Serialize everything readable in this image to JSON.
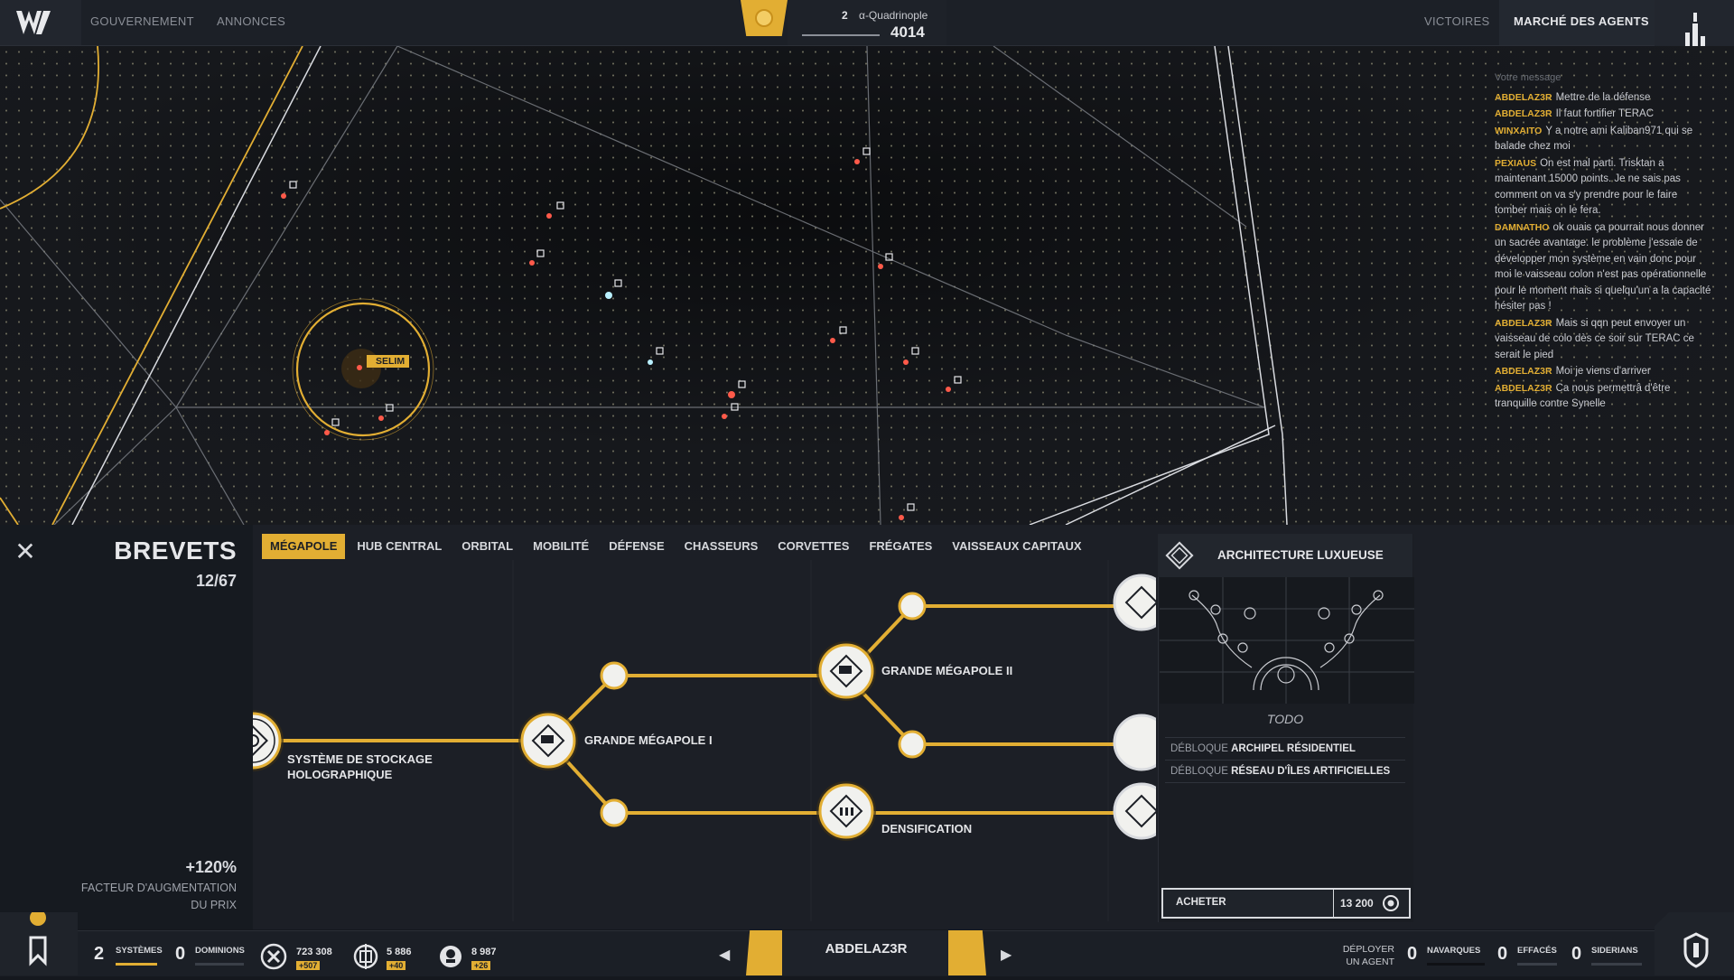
{
  "topbar": {
    "nav_left": [
      "GOUVERNEMENT",
      "ANNONCES"
    ],
    "nav_right": [
      "VICTOIRES",
      "MARCHÉ DES AGENTS"
    ],
    "sector_index": "2",
    "sector_name": "α-Quadrinople",
    "sector_score": "4014"
  },
  "map": {
    "selected_system": "SELIM"
  },
  "chat": {
    "placeholder": "Votre message",
    "messages": [
      {
        "author": "ABDELAZ3R",
        "text": "Mettre de la défense"
      },
      {
        "author": "ABDELAZ3R",
        "text": "Il faut fortifier TERAC"
      },
      {
        "author": "WINXAITO",
        "text": "Y a notre ami Kaliban971 qui se balade chez moi"
      },
      {
        "author": "PEXIAUS",
        "text": "On est mal parti. Trisktan a maintenant 15000 points. Je ne sais pas comment on va s'y prendre pour le faire tomber mais on le fera."
      },
      {
        "author": "DAMNATHO",
        "text": "ok ouais ça pourrait nous donner un sacrée avantage. le problème j'essaie de développer mon système en vain donc pour moi le vaisseau colon n'est pas opérationnelle pour le moment mais si quelqu'un a la capacité hésiter pas !"
      },
      {
        "author": "ABDELAZ3R",
        "text": "Mais si qqn peut envoyer un vaisseau de colo dès ce soir sur TERAC ce serait le pied"
      },
      {
        "author": "ABDELAZ3R",
        "text": "Moi je viens d'arriver"
      },
      {
        "author": "ABDELAZ3R",
        "text": "Ca nous permettrâ d'être tranquille contre Synelle"
      }
    ]
  },
  "panel": {
    "title": "BREVETS",
    "count": "12/67",
    "factor_value": "+120%",
    "factor_label_1": "FACTEUR D'AUGMENTATION",
    "factor_label_2": "DU PRIX",
    "tabs": [
      "MÉGAPOLE",
      "HUB CENTRAL",
      "ORBITAL",
      "MOBILITÉ",
      "DÉFENSE",
      "CHASSEURS",
      "CORVETTES",
      "FRÉGATES",
      "VAISSEAUX CAPITAUX"
    ],
    "active_tab": "MÉGAPOLE",
    "nodes": {
      "n1_line1": "SYSTÈME DE STOCKAGE",
      "n1_line2": "HOLOGRAPHIQUE",
      "n2": "GRANDE MÉGAPOLE I",
      "n3": "GRANDE MÉGAPOLE II",
      "n4": "DENSIFICATION"
    }
  },
  "detail": {
    "title": "ARCHITECTURE LUXUEUSE",
    "todo": "TODO",
    "unlock_prefix": "DÉBLOQUE",
    "unlock_1": "ARCHIPEL RÉSIDENTIEL",
    "unlock_2": "RÉSEAU D'ÎLES ARTIFICIELLES",
    "buy_label": "ACHETER",
    "price": "13 200"
  },
  "footer": {
    "systems_count": "2",
    "systems_label": "SYSTÈMES",
    "dominions_count": "0",
    "dominions_label": "DOMINIONS",
    "resource_1": "723 308",
    "resource_1_delta": "+507",
    "resource_2": "5 886",
    "resource_2_delta": "+40",
    "resource_3": "8 987",
    "resource_3_delta": "+26",
    "player": "ABDELAZ3R",
    "deploy_1": "DÉPLOYER",
    "deploy_2": "UN AGENT",
    "navarques_count": "0",
    "navarques_label": "NAVARQUES",
    "effaces_count": "0",
    "effaces_label": "EFFACÉS",
    "siderians_count": "0",
    "siderians_label": "SIDERIANS"
  },
  "colors": {
    "accent": "#e2ae33",
    "panel": "#1c1f26",
    "map_bg": "#121417"
  }
}
